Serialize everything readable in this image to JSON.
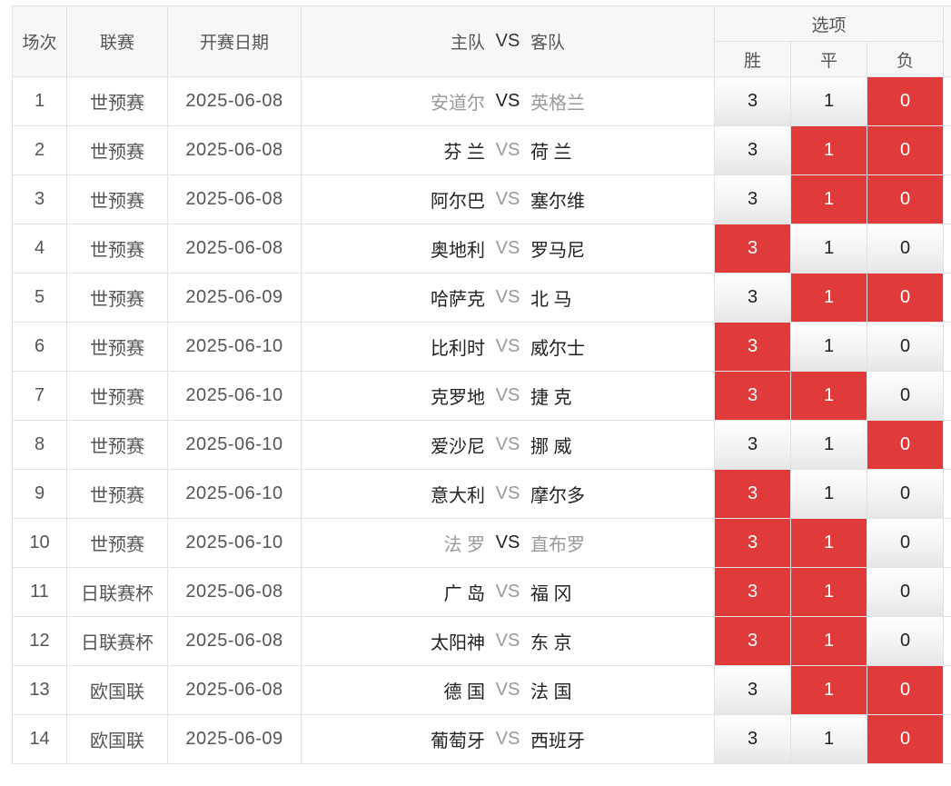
{
  "header": {
    "col_round": "场次",
    "col_league": "联赛",
    "col_date": "开赛日期",
    "col_match_home": "主队",
    "col_match_vs": "VS",
    "col_match_away": "客队",
    "col_options": "选项",
    "opt_win": "胜",
    "opt_draw": "平",
    "opt_lose": "负"
  },
  "colors": {
    "selected": "#e03a3a",
    "border": "#e2e2e2",
    "header_bg": "#f7f7f7"
  },
  "rows": [
    {
      "no": "1",
      "league": "世预赛",
      "date": "2025-06-08",
      "home": "安道尔",
      "vs": "VS",
      "away": "英格兰",
      "dim": true,
      "w": "3",
      "d": "1",
      "l": "0",
      "sel": [
        false,
        false,
        true
      ]
    },
    {
      "no": "2",
      "league": "世预赛",
      "date": "2025-06-08",
      "home": "芬 兰",
      "vs": "VS",
      "away": "荷 兰",
      "dim": false,
      "w": "3",
      "d": "1",
      "l": "0",
      "sel": [
        false,
        true,
        true
      ]
    },
    {
      "no": "3",
      "league": "世预赛",
      "date": "2025-06-08",
      "home": "阿尔巴",
      "vs": "VS",
      "away": "塞尔维",
      "dim": false,
      "w": "3",
      "d": "1",
      "l": "0",
      "sel": [
        false,
        true,
        true
      ]
    },
    {
      "no": "4",
      "league": "世预赛",
      "date": "2025-06-08",
      "home": "奥地利",
      "vs": "VS",
      "away": "罗马尼",
      "dim": false,
      "w": "3",
      "d": "1",
      "l": "0",
      "sel": [
        true,
        false,
        false
      ]
    },
    {
      "no": "5",
      "league": "世预赛",
      "date": "2025-06-09",
      "home": "哈萨克",
      "vs": "VS",
      "away": "北 马",
      "dim": false,
      "w": "3",
      "d": "1",
      "l": "0",
      "sel": [
        false,
        true,
        true
      ]
    },
    {
      "no": "6",
      "league": "世预赛",
      "date": "2025-06-10",
      "home": "比利时",
      "vs": "VS",
      "away": "威尔士",
      "dim": false,
      "w": "3",
      "d": "1",
      "l": "0",
      "sel": [
        true,
        false,
        false
      ]
    },
    {
      "no": "7",
      "league": "世预赛",
      "date": "2025-06-10",
      "home": "克罗地",
      "vs": "VS",
      "away": "捷 克",
      "dim": false,
      "w": "3",
      "d": "1",
      "l": "0",
      "sel": [
        true,
        true,
        false
      ]
    },
    {
      "no": "8",
      "league": "世预赛",
      "date": "2025-06-10",
      "home": "爱沙尼",
      "vs": "VS",
      "away": "挪 威",
      "dim": false,
      "w": "3",
      "d": "1",
      "l": "0",
      "sel": [
        false,
        false,
        true
      ]
    },
    {
      "no": "9",
      "league": "世预赛",
      "date": "2025-06-10",
      "home": "意大利",
      "vs": "VS",
      "away": "摩尔多",
      "dim": false,
      "w": "3",
      "d": "1",
      "l": "0",
      "sel": [
        true,
        false,
        false
      ]
    },
    {
      "no": "10",
      "league": "世预赛",
      "date": "2025-06-10",
      "home": "法 罗",
      "vs": "VS",
      "away": "直布罗",
      "dim": true,
      "w": "3",
      "d": "1",
      "l": "0",
      "sel": [
        true,
        true,
        false
      ]
    },
    {
      "no": "11",
      "league": "日联赛杯",
      "date": "2025-06-08",
      "home": "广 岛",
      "vs": "VS",
      "away": "福 冈",
      "dim": false,
      "w": "3",
      "d": "1",
      "l": "0",
      "sel": [
        true,
        true,
        false
      ]
    },
    {
      "no": "12",
      "league": "日联赛杯",
      "date": "2025-06-08",
      "home": "太阳神",
      "vs": "VS",
      "away": "东 京",
      "dim": false,
      "w": "3",
      "d": "1",
      "l": "0",
      "sel": [
        true,
        true,
        false
      ]
    },
    {
      "no": "13",
      "league": "欧国联",
      "date": "2025-06-08",
      "home": "德 国",
      "vs": "VS",
      "away": "法 国",
      "dim": false,
      "w": "3",
      "d": "1",
      "l": "0",
      "sel": [
        false,
        true,
        true
      ]
    },
    {
      "no": "14",
      "league": "欧国联",
      "date": "2025-06-09",
      "home": "葡萄牙",
      "vs": "VS",
      "away": "西班牙",
      "dim": false,
      "w": "3",
      "d": "1",
      "l": "0",
      "sel": [
        false,
        false,
        true
      ]
    }
  ]
}
